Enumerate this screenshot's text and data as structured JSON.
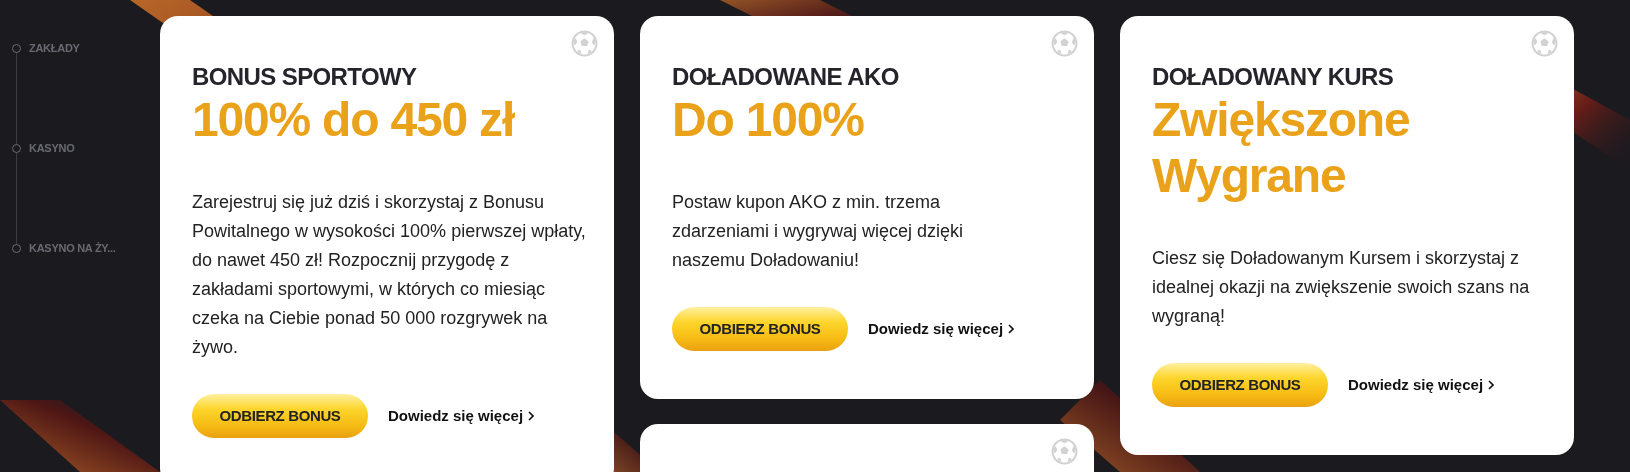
{
  "sidebar": {
    "items": [
      {
        "label": "ZAKŁADY"
      },
      {
        "label": "KASYNO"
      },
      {
        "label": "KASYNO NA ŻY..."
      }
    ]
  },
  "columns": [
    [
      {
        "kind": "sport",
        "title": "BONUS SPORTOWY",
        "highlight": "100% do 450 zł",
        "description": "Zarejestruj się już dziś i skorzystaj z Bonusu Powitalnego w wysokości 100% pierwszej wpłaty, do nawet 450 zł! Rozpocznij przygodę z zakładami sportowymi, w których co miesiąc czeka na Ciebie ponad 50 000 rozgrywek na żywo.",
        "button": "ODBIERZ BONUS",
        "link": "Dowiedz się więcej"
      }
    ],
    [
      {
        "kind": "sport",
        "title": "DOŁADOWANE AKO",
        "highlight": "Do 100%",
        "description": "Postaw kupon AKO z min. trzema zdarzeniami i wygrywaj więcej dzięki naszemu Doładowaniu!",
        "button": "ODBIERZ BONUS",
        "link": "Dowiedz się więcej"
      },
      {
        "kind": "sport"
      }
    ],
    [
      {
        "kind": "sport",
        "title": "DOŁADOWANY KURS",
        "highlight": "Zwiększone Wygrane",
        "description": "Ciesz się Doładowanym Kursem i skorzystaj z idealnej okazji na zwiększenie swoich szans na wygraną!",
        "button": "ODBIERZ BONUS",
        "link": "Dowiedz się więcej"
      }
    ]
  ]
}
